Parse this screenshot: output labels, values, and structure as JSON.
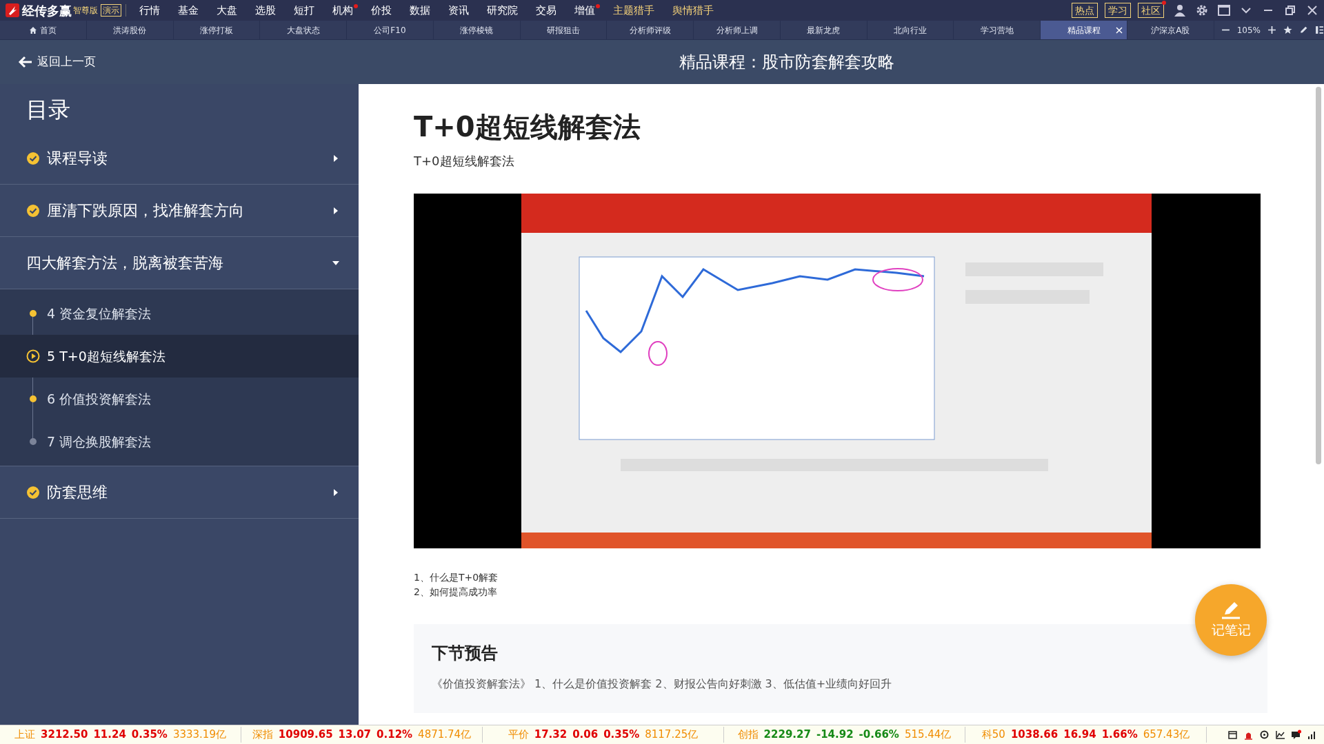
{
  "app_bar": {
    "logo": "经传多赢",
    "edition": "智尊版",
    "demo_badge": "演示",
    "menu": [
      {
        "label": "行情",
        "dot": false,
        "highlight": false
      },
      {
        "label": "基金",
        "dot": false,
        "highlight": false
      },
      {
        "label": "大盘",
        "dot": false,
        "highlight": false
      },
      {
        "label": "选股",
        "dot": false,
        "highlight": false
      },
      {
        "label": "短打",
        "dot": false,
        "highlight": false
      },
      {
        "label": "机构",
        "dot": true,
        "highlight": false
      },
      {
        "label": "价投",
        "dot": false,
        "highlight": false
      },
      {
        "label": "数据",
        "dot": false,
        "highlight": false
      },
      {
        "label": "资讯",
        "dot": false,
        "highlight": false
      },
      {
        "label": "研究院",
        "dot": false,
        "highlight": false
      },
      {
        "label": "交易",
        "dot": false,
        "highlight": false
      },
      {
        "label": "增值",
        "dot": true,
        "highlight": false
      },
      {
        "label": "主题猎手",
        "dot": false,
        "highlight": true
      },
      {
        "label": "舆情猎手",
        "dot": false,
        "highlight": true
      }
    ],
    "right_buttons": [
      {
        "label": "热点",
        "dot": false
      },
      {
        "label": "学习",
        "dot": false
      },
      {
        "label": "社区",
        "dot": true
      }
    ]
  },
  "tabs": [
    {
      "label": "首页",
      "kind": "home",
      "selected": false,
      "closable": false
    },
    {
      "label": "洪涛股份",
      "kind": "page",
      "selected": false,
      "closable": false
    },
    {
      "label": "涨停打板",
      "kind": "page",
      "selected": false,
      "closable": false
    },
    {
      "label": "大盘状态",
      "kind": "page",
      "selected": false,
      "closable": false
    },
    {
      "label": "公司F10",
      "kind": "page",
      "selected": false,
      "closable": false
    },
    {
      "label": "涨停棱镜",
      "kind": "page",
      "selected": false,
      "closable": false
    },
    {
      "label": "研报狙击",
      "kind": "page",
      "selected": false,
      "closable": false
    },
    {
      "label": "分析师评级",
      "kind": "page",
      "selected": false,
      "closable": false
    },
    {
      "label": "分析师上调",
      "kind": "page",
      "selected": false,
      "closable": false
    },
    {
      "label": "最新龙虎",
      "kind": "page",
      "selected": false,
      "closable": false
    },
    {
      "label": "北向行业",
      "kind": "page",
      "selected": false,
      "closable": false
    },
    {
      "label": "学习营地",
      "kind": "page",
      "selected": false,
      "closable": false
    },
    {
      "label": "精品课程",
      "kind": "page",
      "selected": true,
      "closable": true
    },
    {
      "label": "沪深京A股",
      "kind": "page",
      "selected": false,
      "closable": false
    }
  ],
  "zoom": "105%",
  "header": {
    "back": "返回上一页",
    "title": "精品课程：股市防套解套攻略"
  },
  "toc": {
    "title": "目录",
    "sections": [
      {
        "label": "课程导读",
        "checked": true,
        "expanded": false
      },
      {
        "label": "厘清下跌原因，找准解套方向",
        "checked": true,
        "expanded": false
      },
      {
        "label": "四大解套方法，脱离被套苦海",
        "checked": false,
        "expanded": true,
        "children": [
          {
            "label": "4 资金复位解套法",
            "kind": "done",
            "selected": false
          },
          {
            "label": "5 T+0超短线解套法",
            "kind": "playing",
            "selected": true
          },
          {
            "label": "6 价值投资解套法",
            "kind": "done",
            "selected": false
          },
          {
            "label": "7 调仓换股解套法",
            "kind": "pending",
            "selected": false
          }
        ]
      },
      {
        "label": "防套思维",
        "checked": true,
        "expanded": false
      }
    ]
  },
  "lesson": {
    "title": "T+0超短线解套法",
    "subtitle": "T+0超短线解套法",
    "video": {
      "kind": "picture"
    },
    "points": [
      "1、什么是T+0解套",
      "2、如何提高成功率"
    ],
    "preview": {
      "heading": "下节预告",
      "text": "《价值投资解套法》 1、什么是价值投资解套 2、财报公告向好刺激 3、低估值+业绩向好回升"
    }
  },
  "note_button": "记笔记",
  "tickers": [
    {
      "name": "上证",
      "price": "3212.50",
      "change": "11.24",
      "pct": "0.35%",
      "amount": "3333.19亿",
      "falling": false
    },
    {
      "name": "深指",
      "price": "10909.65",
      "change": "13.07",
      "pct": "0.12%",
      "amount": "4871.74亿",
      "falling": false
    },
    {
      "name": "平价",
      "price": "17.32",
      "change": "0.06",
      "pct": "0.35%",
      "amount": "8117.25亿",
      "falling": false
    },
    {
      "name": "创指",
      "price": "2229.27",
      "change": "-14.92",
      "pct": "-0.66%",
      "amount": "515.44亿",
      "falling": true
    },
    {
      "name": "科50",
      "price": "1038.66",
      "change": "16.94",
      "pct": "1.66%",
      "amount": "657.43亿",
      "falling": false
    }
  ]
}
